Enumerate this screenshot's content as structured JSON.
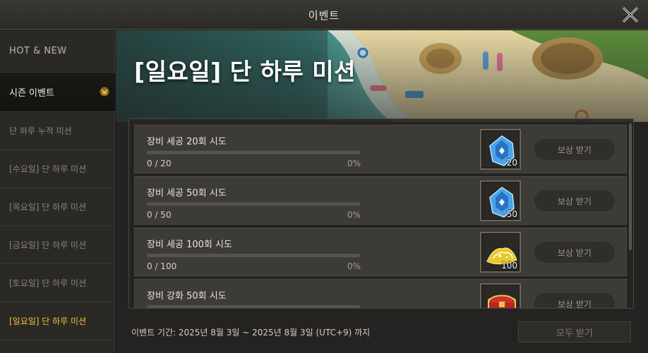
{
  "window": {
    "title": "이벤트"
  },
  "sidebar": {
    "items": [
      {
        "label": "HOT & NEW"
      },
      {
        "label": "시즌 이벤트"
      },
      {
        "label": "단 하루 누적 미션"
      },
      {
        "label": "[수요일] 단 하루 미션"
      },
      {
        "label": "[목요일] 단 하루 미션"
      },
      {
        "label": "[금요일] 단 하루 미션"
      },
      {
        "label": "[토요일] 단 하루 미션"
      },
      {
        "label": "[일요일] 단 하루 미션"
      }
    ]
  },
  "banner": {
    "title": "[일요일] 단 하루 미션"
  },
  "missions": [
    {
      "title": "장비 세공 20회 시도",
      "count": "0 / 20",
      "percent": "0%",
      "progress": 0,
      "reward_icon": "blue-crystal-icon",
      "reward_qty": "20",
      "claim_label": "보상 받기"
    },
    {
      "title": "장비 세공 50회 시도",
      "count": "0 / 50",
      "percent": "0%",
      "progress": 0,
      "reward_icon": "blue-crystal-icon",
      "reward_qty": "50",
      "claim_label": "보상 받기"
    },
    {
      "title": "장비 세공 100회 시도",
      "count": "0 / 100",
      "percent": "0%",
      "progress": 0,
      "reward_icon": "gold-dust-icon",
      "reward_qty": "100",
      "claim_label": "보상 받기"
    },
    {
      "title": "장비 강화 50회 시도",
      "count": "",
      "percent": "",
      "progress": 0,
      "reward_icon": "treasure-chest-icon",
      "reward_qty": "",
      "claim_label": "보상 받기"
    }
  ],
  "footer": {
    "period": "이벤트 기간: 2025년 8월 3일 ~ 2025년 8월 3일 (UTC+9) 까지",
    "claim_all_label": "모두 받기"
  },
  "colors": {
    "accent": "#f0c23a",
    "panel": "#3d3b37"
  }
}
